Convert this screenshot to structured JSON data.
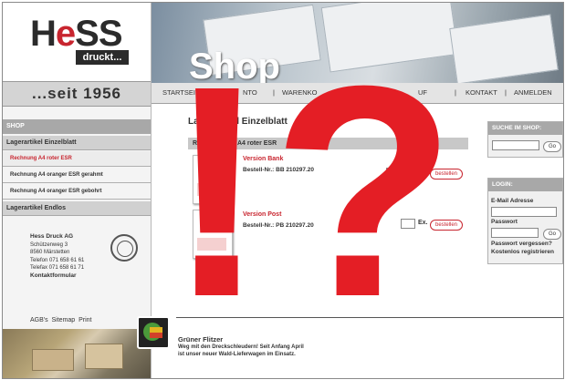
{
  "logo": {
    "main_prefix": "H",
    "main_e": "e",
    "main_suffix": "SS",
    "sub": "druckt..."
  },
  "since": "...seit 1956",
  "header": {
    "title": "Shop"
  },
  "topnav": [
    "STARTSEITE",
    "NTO",
    "WARENKO",
    "UF",
    "KONTAKT",
    "ANMELDEN"
  ],
  "sidebar": {
    "head": "SHOP",
    "cat1": "Lagerartikel Einzelblatt",
    "items": [
      "Rechnung A4 roter ESR",
      "Rechnung A4 oranger ESR gerahmt",
      "Rechnung A4 oranger ESR gebohrt"
    ],
    "cat2": "Lagerartikel Endlos"
  },
  "contact": {
    "company": "Hess Druck AG",
    "street": "Schützenweg 3",
    "city": "8560 Märstetten",
    "phone": "Telefon 071 658 61 61",
    "fax": "Telefax 071 658 61 71",
    "form": "Kontaktformular"
  },
  "footer_links": [
    "AGB's",
    "Sitemap",
    "Print"
  ],
  "main": {
    "title": "Lagerartikel Einzelblatt",
    "title_a": "La",
    "title_b": "el Einzelblatt",
    "table_head_a": "Re",
    "table_head_b": "A4 roter ESR",
    "products": [
      {
        "name": "Version Bank",
        "nr": "Bestell-Nr.: BB 210297.20",
        "btn": "bestellen"
      },
      {
        "name": "Version Post",
        "nr": "Bestell-Nr.: PB 210297.20",
        "ex": "Ex.",
        "btn": "bestellen"
      }
    ]
  },
  "news": {
    "title": "Grüner Flitzer",
    "line1": "Weg mit den Dreckschleudern! Seit Anfang April",
    "line2": "ist unser neuer Wald-Lieferwagen im Einsatz."
  },
  "search": {
    "head": "SUCHE IM SHOP:",
    "go": "Go"
  },
  "login": {
    "head": "LOGIN:",
    "email_label": "E-Mail Adresse",
    "password_label": "Passwort",
    "go": "Go",
    "forgot": "Passwort vergessen?",
    "register": "Kostenlos registrieren"
  },
  "overlay": {
    "exclaim": "!",
    "question": "?"
  },
  "colors": {
    "accent": "#e41e25",
    "text": "#333333",
    "panel": "#a8a8a8"
  }
}
